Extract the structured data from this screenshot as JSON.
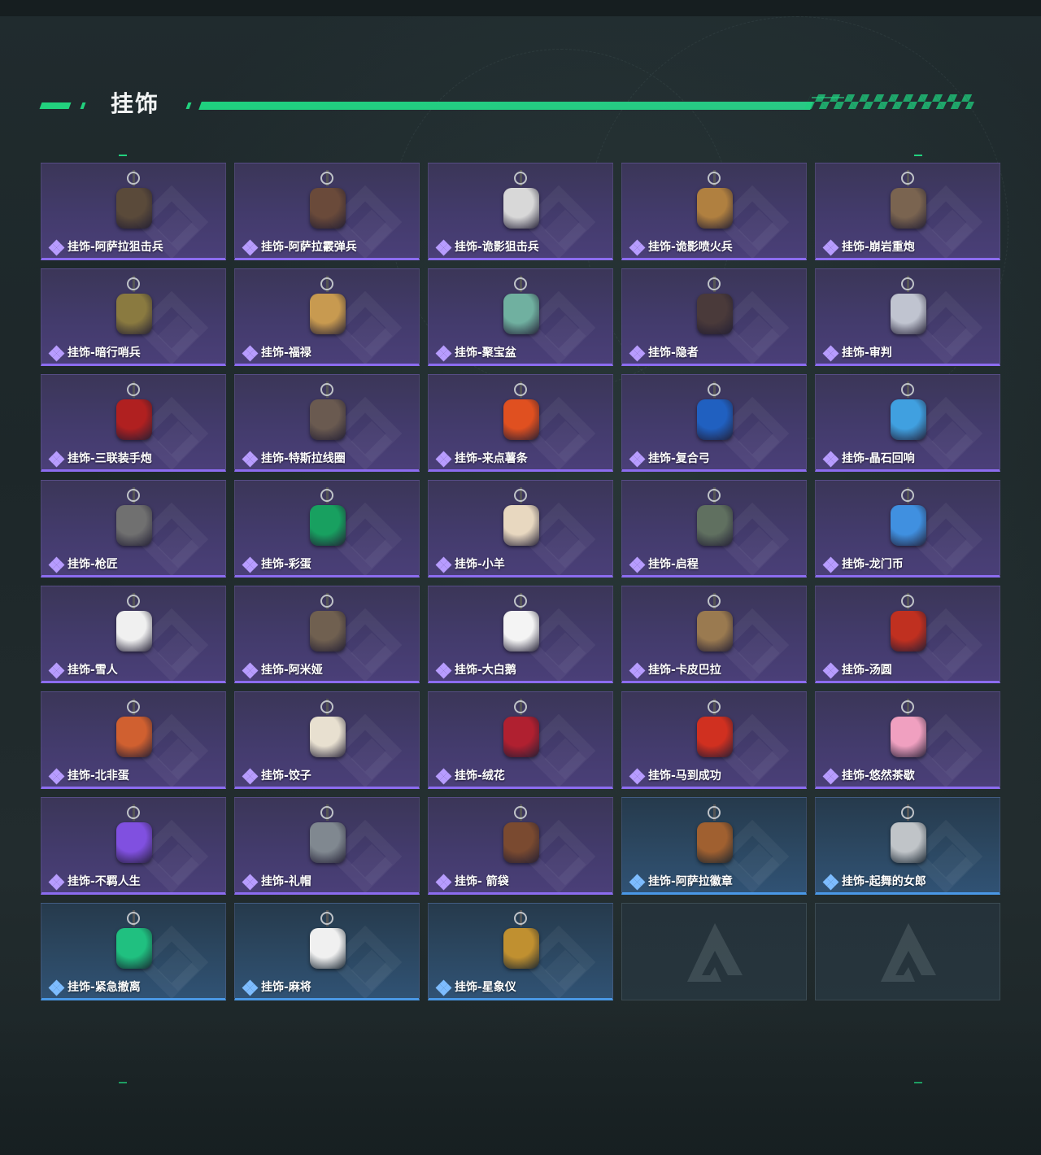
{
  "header": {
    "title": "挂饰"
  },
  "colors": {
    "accent": "#22d17e",
    "purple_rarity": "#8c6cf0",
    "blue_rarity": "#4a98e6"
  },
  "items": [
    {
      "label": "挂饰-阿萨拉狙击兵",
      "rarity": "purple",
      "icon": "soldier-charm-icon",
      "color": "#5a4a3a"
    },
    {
      "label": "挂饰-阿萨拉霰弹兵",
      "rarity": "purple",
      "icon": "soldier-charm-icon",
      "color": "#6a4a3a"
    },
    {
      "label": "挂饰-诡影狙击兵",
      "rarity": "purple",
      "icon": "masked-soldier-charm-icon",
      "color": "#d8d8d8"
    },
    {
      "label": "挂饰-诡影喷火兵",
      "rarity": "purple",
      "icon": "masked-soldier-charm-icon",
      "color": "#b08040"
    },
    {
      "label": "挂饰-崩岩重炮",
      "rarity": "purple",
      "icon": "soldier-charm-icon",
      "color": "#7a6450"
    },
    {
      "label": "挂饰-暗行哨兵",
      "rarity": "purple",
      "icon": "soldier-charm-icon",
      "color": "#8a7a40"
    },
    {
      "label": "挂饰-福禄",
      "rarity": "purple",
      "icon": "gourd-charm-icon",
      "color": "#c89a50"
    },
    {
      "label": "挂饰-聚宝盆",
      "rarity": "purple",
      "icon": "treasure-bowl-charm-icon",
      "color": "#70b0a0"
    },
    {
      "label": "挂饰-隐者",
      "rarity": "purple",
      "icon": "tarot-card-charm-icon",
      "color": "#4a3a3a"
    },
    {
      "label": "挂饰-审判",
      "rarity": "purple",
      "icon": "tarot-card-charm-icon",
      "color": "#c0c4d0"
    },
    {
      "label": "挂饰-三联装手炮",
      "rarity": "purple",
      "icon": "launcher-charm-icon",
      "color": "#b02020"
    },
    {
      "label": "挂饰-特斯拉线圈",
      "rarity": "purple",
      "icon": "tesla-coil-charm-icon",
      "color": "#6a5a50"
    },
    {
      "label": "挂饰-来点薯条",
      "rarity": "purple",
      "icon": "fries-charm-icon",
      "color": "#e05020"
    },
    {
      "label": "挂饰-复合弓",
      "rarity": "purple",
      "icon": "bow-charm-icon",
      "color": "#2060c0"
    },
    {
      "label": "挂饰-晶石回响",
      "rarity": "purple",
      "icon": "crystal-charm-icon",
      "color": "#40a0e0"
    },
    {
      "label": "挂饰-枪匠",
      "rarity": "purple",
      "icon": "gunsmith-plate-charm-icon",
      "color": "#707070"
    },
    {
      "label": "挂饰-彩蛋",
      "rarity": "purple",
      "icon": "egg-charm-icon",
      "color": "#18a060"
    },
    {
      "label": "挂饰-小羊",
      "rarity": "purple",
      "icon": "lamb-charm-icon",
      "color": "#e8d8c0"
    },
    {
      "label": "挂饰-启程",
      "rarity": "purple",
      "icon": "medal-charm-icon",
      "color": "#607060"
    },
    {
      "label": "挂饰-龙门币",
      "rarity": "purple",
      "icon": "card-charm-icon",
      "color": "#4090e0"
    },
    {
      "label": "挂饰-雪人",
      "rarity": "purple",
      "icon": "snowman-charm-icon",
      "color": "#f0f0f0"
    },
    {
      "label": "挂饰-阿米娅",
      "rarity": "purple",
      "icon": "bunny-charm-icon",
      "color": "#706050"
    },
    {
      "label": "挂饰-大白鹅",
      "rarity": "purple",
      "icon": "goose-charm-icon",
      "color": "#f4f4f4"
    },
    {
      "label": "挂饰-卡皮巴拉",
      "rarity": "purple",
      "icon": "capybara-charm-icon",
      "color": "#9a7a50"
    },
    {
      "label": "挂饰-汤圆",
      "rarity": "purple",
      "icon": "dumpling-bowl-charm-icon",
      "color": "#c03020"
    },
    {
      "label": "挂饰-北非蛋",
      "rarity": "purple",
      "icon": "shakshuka-charm-icon",
      "color": "#d06030"
    },
    {
      "label": "挂饰-饺子",
      "rarity": "purple",
      "icon": "dumplings-plate-charm-icon",
      "color": "#e8e0d0"
    },
    {
      "label": "挂饰-绒花",
      "rarity": "purple",
      "icon": "flower-charm-icon",
      "color": "#b02030"
    },
    {
      "label": "挂饰-马到成功",
      "rarity": "purple",
      "icon": "horse-charm-icon",
      "color": "#d03020"
    },
    {
      "label": "挂饰-悠然茶歇",
      "rarity": "purple",
      "icon": "cupcake-charm-icon",
      "color": "#f0a0c0"
    },
    {
      "label": "挂饰-不羁人生",
      "rarity": "purple",
      "icon": "sneaker-charm-icon",
      "color": "#8050e0"
    },
    {
      "label": "挂饰-礼帽",
      "rarity": "purple",
      "icon": "hat-charm-icon",
      "color": "#808890"
    },
    {
      "label": "挂饰- 箭袋",
      "rarity": "purple",
      "icon": "quiver-charm-icon",
      "color": "#7a4a30"
    },
    {
      "label": "挂饰-阿萨拉徽章",
      "rarity": "blue",
      "icon": "badge-charm-icon",
      "color": "#a06030"
    },
    {
      "label": "挂饰-起舞的女郎",
      "rarity": "blue",
      "icon": "dancer-charm-icon",
      "color": "#c0c4c8"
    },
    {
      "label": "挂饰-紧急撤离",
      "rarity": "blue",
      "icon": "exit-sign-charm-icon",
      "color": "#20c080"
    },
    {
      "label": "挂饰-麻将",
      "rarity": "blue",
      "icon": "mahjong-charm-icon",
      "color": "#f0f0f0"
    },
    {
      "label": "挂饰-星象仪",
      "rarity": "blue",
      "icon": "astrolabe-charm-icon",
      "color": "#c09030"
    }
  ],
  "empty_slots": [
    {
      "icon": "game-logo-icon"
    },
    {
      "icon": "game-logo-icon"
    }
  ]
}
